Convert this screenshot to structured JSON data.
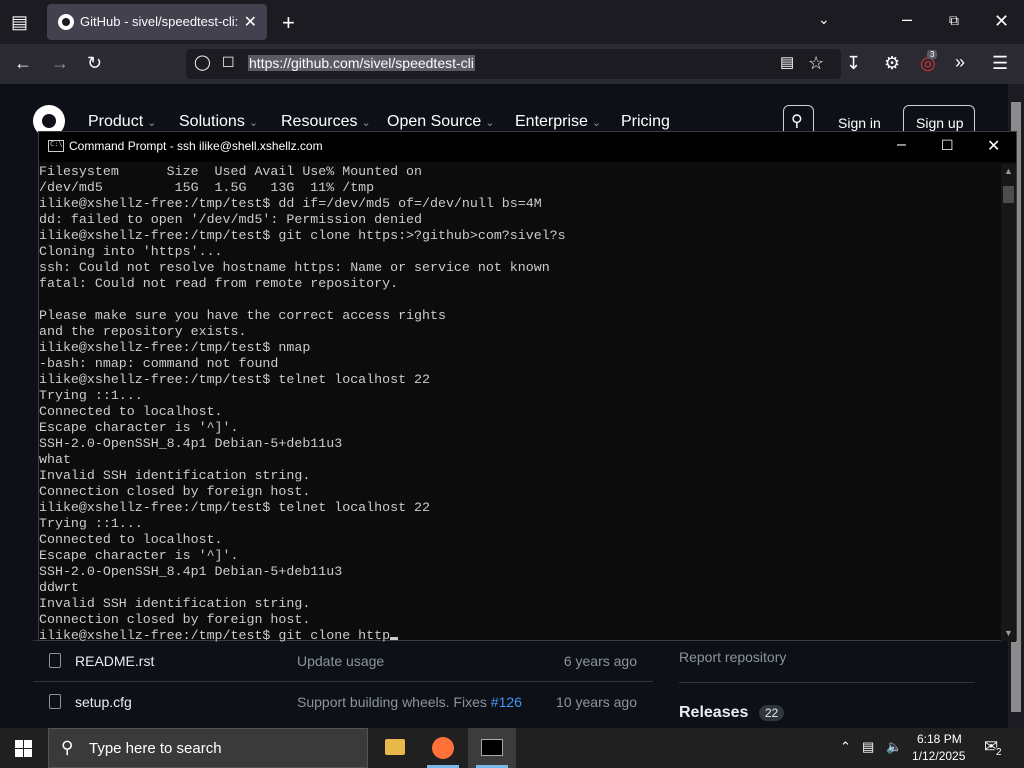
{
  "browser": {
    "tab_title": "GitHub - sivel/speedtest-cli: Co",
    "url": "https://github.com/sivel/speedtest-cli",
    "extension_badge": "3"
  },
  "github": {
    "nav": [
      "Product",
      "Solutions",
      "Resources",
      "Open Source",
      "Enterprise",
      "Pricing"
    ],
    "sign_in": "Sign in",
    "sign_up": "Sign up",
    "files": [
      {
        "name": "README.rst",
        "message": "Update usage",
        "link": "",
        "when": "6 years ago"
      },
      {
        "name": "setup.cfg",
        "message": "Support building wheels. Fixes ",
        "link": "#126",
        "when": "10 years ago"
      }
    ],
    "report_repository": "Report repository",
    "releases_label": "Releases",
    "releases_count": "22"
  },
  "cmd": {
    "title": "Command Prompt - ssh  ilike@shell.xshellz.com",
    "lines": [
      "Filesystem      Size  Used Avail Use% Mounted on",
      "/dev/md5         15G  1.5G   13G  11% /tmp",
      "ilike@xshellz-free:/tmp/test$ dd if=/dev/md5 of=/dev/null bs=4M",
      "dd: failed to open '/dev/md5': Permission denied",
      "ilike@xshellz-free:/tmp/test$ git clone https:>?github>com?sivel?s",
      "Cloning into 'https'...",
      "ssh: Could not resolve hostname https: Name or service not known",
      "fatal: Could not read from remote repository.",
      "",
      "Please make sure you have the correct access rights",
      "and the repository exists.",
      "ilike@xshellz-free:/tmp/test$ nmap",
      "-bash: nmap: command not found",
      "ilike@xshellz-free:/tmp/test$ telnet localhost 22",
      "Trying ::1...",
      "Connected to localhost.",
      "Escape character is '^]'.",
      "SSH-2.0-OpenSSH_8.4p1 Debian-5+deb11u3",
      "what",
      "Invalid SSH identification string.",
      "Connection closed by foreign host.",
      "ilike@xshellz-free:/tmp/test$ telnet localhost 22",
      "Trying ::1...",
      "Connected to localhost.",
      "Escape character is '^]'.",
      "SSH-2.0-OpenSSH_8.4p1 Debian-5+deb11u3",
      "ddwrt",
      "Invalid SSH identification string.",
      "Connection closed by foreign host.",
      "ilike@xshellz-free:/tmp/test$ git clone http"
    ]
  },
  "taskbar": {
    "search_placeholder": "Type here to search",
    "time": "6:18 PM",
    "date": "1/12/2025",
    "notification_count": "2"
  }
}
